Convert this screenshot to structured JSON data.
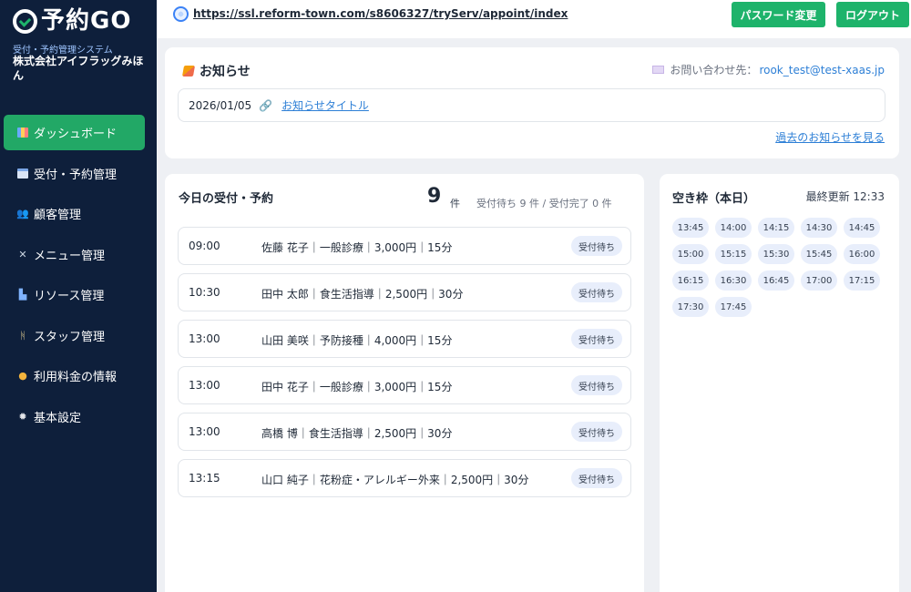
{
  "sidebar": {
    "logo": "予約GO",
    "subtitle": "受付・予約管理システム",
    "company": "株式会社アイフラッグみほん",
    "items": [
      {
        "label": "ダッシュボード",
        "icon": "dashboard-icon",
        "active": true
      },
      {
        "label": "受付・予約管理",
        "icon": "calendar-icon"
      },
      {
        "label": "顧客管理",
        "icon": "users-icon"
      },
      {
        "label": "メニュー管理",
        "icon": "tools-icon"
      },
      {
        "label": "リソース管理",
        "icon": "resource-icon"
      },
      {
        "label": "スタッフ管理",
        "icon": "staff-icon"
      },
      {
        "label": "利用料金の情報",
        "icon": "money-bag-icon"
      },
      {
        "label": "基本設定",
        "icon": "gear-icon"
      }
    ]
  },
  "topbar": {
    "url": "https://ssl.reform-town.com/s8606327/tryServ/appoint/index",
    "password_button": "パスワード変更",
    "logout_button": "ログアウト"
  },
  "notice": {
    "title": "お知らせ",
    "contact_label": "お問い合わせ先：",
    "contact_email": "rook_test@test-xaas.jp",
    "items": [
      {
        "date": "2026/01/05",
        "title": "お知らせタイトル"
      }
    ],
    "past_link": "過去のお知らせを見る"
  },
  "bookings": {
    "title": "今日の受付・予約",
    "count": "9",
    "unit": "件",
    "summary": "受付待ち 9 件 / 受付完了 0 件",
    "rows": [
      {
        "time": "09:00",
        "desc": "佐藤 花子｜一般診療｜3,000円｜15分",
        "status": "受付待ち"
      },
      {
        "time": "10:30",
        "desc": "田中 太郎｜食生活指導｜2,500円｜30分",
        "status": "受付待ち"
      },
      {
        "time": "13:00",
        "desc": "山田 美咲｜予防接種｜4,000円｜15分",
        "status": "受付待ち"
      },
      {
        "time": "13:00",
        "desc": "田中 花子｜一般診療｜3,000円｜15分",
        "status": "受付待ち"
      },
      {
        "time": "13:00",
        "desc": "高橋 博｜食生活指導｜2,500円｜30分",
        "status": "受付待ち"
      },
      {
        "time": "13:15",
        "desc": "山口 純子｜花粉症・アレルギー外来｜2,500円｜30分",
        "status": "受付待ち"
      }
    ]
  },
  "slots": {
    "title": "空き枠（本日）",
    "updated": "最終更新 12:33",
    "times": [
      "13:45",
      "14:00",
      "14:15",
      "14:30",
      "14:45",
      "15:00",
      "15:15",
      "15:30",
      "15:45",
      "16:00",
      "16:15",
      "16:30",
      "16:45",
      "17:00",
      "17:15",
      "17:30",
      "17:45"
    ]
  },
  "colors": {
    "sidebar_bg": "#0e1f3b",
    "accent_green": "#1eb36b",
    "link_blue": "#2d7fd6"
  }
}
